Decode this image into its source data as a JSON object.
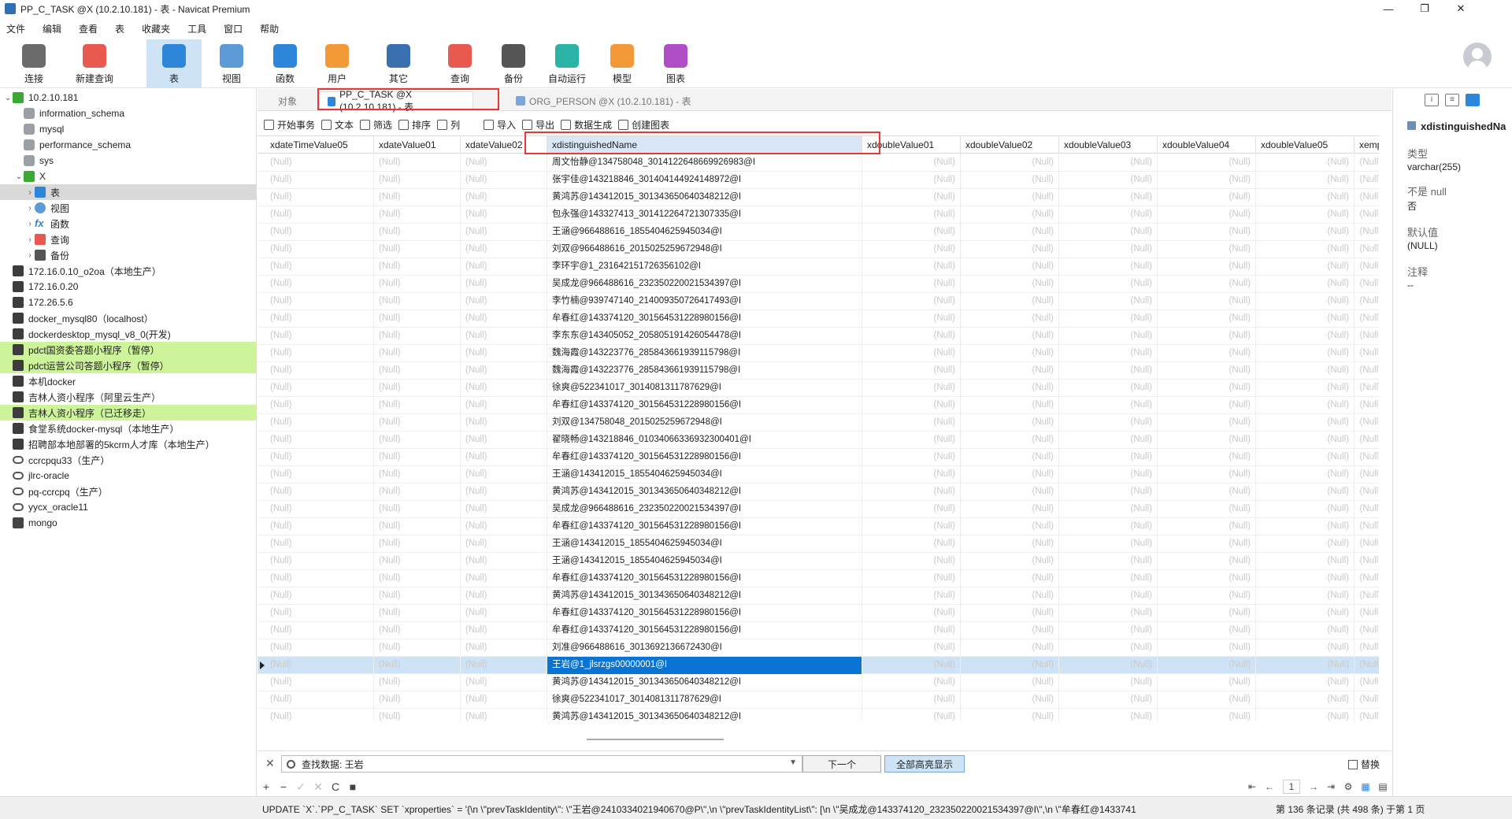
{
  "window": {
    "title": "PP_C_TASK @X (10.2.10.181) - 表 - Navicat Premium",
    "minimize": "—",
    "maximize": "❐",
    "close": "✕"
  },
  "menu": [
    "文件",
    "编辑",
    "查看",
    "表",
    "收藏夹",
    "工具",
    "窗口",
    "帮助"
  ],
  "toolbar": [
    {
      "label": "连接",
      "icon": "plug-icon",
      "color": "#6b6b6b"
    },
    {
      "label": "新建查询",
      "icon": "new-query-icon",
      "color": "#e85a4f"
    },
    {
      "label": "表",
      "icon": "table-icon",
      "color": "#2d86d9",
      "active": true
    },
    {
      "label": "视图",
      "icon": "view-icon",
      "color": "#5c9bd6"
    },
    {
      "label": "函数",
      "icon": "function-icon",
      "color": "#2d86d9"
    },
    {
      "label": "用户",
      "icon": "user-icon",
      "color": "#f29a38"
    },
    {
      "label": "其它",
      "icon": "tools-icon",
      "color": "#3a6fb0"
    },
    {
      "label": "查询",
      "icon": "query-icon",
      "color": "#e85a4f"
    },
    {
      "label": "备份",
      "icon": "backup-icon",
      "color": "#555555"
    },
    {
      "label": "自动运行",
      "icon": "robot-icon",
      "color": "#2bb3a6"
    },
    {
      "label": "模型",
      "icon": "model-icon",
      "color": "#f29a38"
    },
    {
      "label": "图表",
      "icon": "chart-icon",
      "color": "#b04ec7"
    }
  ],
  "sidebar": {
    "items": [
      {
        "label": "10.2.10.181",
        "indent": 0,
        "arrow": "v",
        "icon": "srvg"
      },
      {
        "label": "information_schema",
        "indent": 1,
        "arrow": "",
        "icon": "db"
      },
      {
        "label": "mysql",
        "indent": 1,
        "arrow": "",
        "icon": "db"
      },
      {
        "label": "performance_schema",
        "indent": 1,
        "arrow": "",
        "icon": "db"
      },
      {
        "label": "sys",
        "indent": 1,
        "arrow": "",
        "icon": "db"
      },
      {
        "label": "X",
        "indent": 1,
        "arrow": "v",
        "icon": "srvg"
      },
      {
        "label": "表",
        "indent": 2,
        "arrow": ">",
        "icon": "tbl",
        "state": "sel"
      },
      {
        "label": "视图",
        "indent": 2,
        "arrow": ">",
        "icon": "view"
      },
      {
        "label": "函数",
        "indent": 2,
        "arrow": ">",
        "icon": "fx"
      },
      {
        "label": "查询",
        "indent": 2,
        "arrow": ">",
        "icon": "qry"
      },
      {
        "label": "备份",
        "indent": 2,
        "arrow": ">",
        "icon": "bak"
      },
      {
        "label": "172.16.0.10_o2oa（本地生产）",
        "indent": 0,
        "arrow": "",
        "icon": "srv"
      },
      {
        "label": "172.16.0.20",
        "indent": 0,
        "arrow": "",
        "icon": "srv"
      },
      {
        "label": "172.26.5.6",
        "indent": 0,
        "arrow": "",
        "icon": "srv"
      },
      {
        "label": "docker_mysql80（localhost）",
        "indent": 0,
        "arrow": "",
        "icon": "srv"
      },
      {
        "label": "dockerdesktop_mysql_v8_0(开发)",
        "indent": 0,
        "arrow": "",
        "icon": "srv"
      },
      {
        "label": "pdct国资委答题小程序（暂停）",
        "indent": 0,
        "arrow": "",
        "icon": "srv",
        "state": "hl"
      },
      {
        "label": "pdct运营公司答题小程序（暂停）",
        "indent": 0,
        "arrow": "",
        "icon": "srv",
        "state": "hl"
      },
      {
        "label": "本机docker",
        "indent": 0,
        "arrow": "",
        "icon": "srv"
      },
      {
        "label": "吉林人资小程序（阿里云生产）",
        "indent": 0,
        "arrow": "",
        "icon": "srv"
      },
      {
        "label": "吉林人资小程序（已迁移走）",
        "indent": 0,
        "arrow": "",
        "icon": "srv",
        "state": "hl"
      },
      {
        "label": "食堂系统docker-mysql（本地生产）",
        "indent": 0,
        "arrow": "",
        "icon": "srv"
      },
      {
        "label": "招聘部本地部署的5kcrm人才库（本地生产）",
        "indent": 0,
        "arrow": "",
        "icon": "srv"
      },
      {
        "label": "ccrcpqu33（生产）",
        "indent": 0,
        "arrow": "",
        "icon": "ora"
      },
      {
        "label": "jlrc-oracle",
        "indent": 0,
        "arrow": "",
        "icon": "ora"
      },
      {
        "label": "pq-ccrcpq（生产）",
        "indent": 0,
        "arrow": "",
        "icon": "ora"
      },
      {
        "label": "yycx_oracle11",
        "indent": 0,
        "arrow": "",
        "icon": "ora"
      },
      {
        "label": "mongo",
        "indent": 0,
        "arrow": "",
        "icon": "mongo"
      }
    ]
  },
  "tabs": {
    "objects": "对象",
    "active": "PP_C_TASK @X (10.2.10.181) - 表",
    "other": "ORG_PERSON @X (10.2.10.181) - 表"
  },
  "subtoolbar": [
    "开始事务",
    "文本",
    "筛选",
    "排序",
    "列",
    "导入",
    "导出",
    "数据生成",
    "创建图表"
  ],
  "grid": {
    "columns": [
      "xdateTimeValue05",
      "xdateValue01",
      "xdateValue02",
      "xdistinguishedName",
      "xdoubleValue01",
      "xdoubleValue02",
      "xdoubleValue03",
      "xdoubleValue04",
      "xdoubleValue05",
      "xemp"
    ],
    "null_text": "(Null)",
    "names": [
      "周文怡静@134758048_3014122648669926983@I",
      "张宇佳@143218846_3014041449241489​72@I",
      "黄鸿苏@143412015_3013436506403482​12@I",
      "包永强@143327413_3014122647213073​35@I",
      "王涵@966488616_1855404625945034@I",
      "刘双@966488616_2015025259672948@I",
      "李环宇@1_2316421517263561​02@I",
      "吴成龙@966488616_2323502200215343​97@I",
      "李竹楠@939747140_2140093507264174​93@I",
      "牟春红@143374120_3015645312289801​56@I",
      "李东东@143405052_2058051914260544​78@I",
      "魏海霞@143223776_2858436619391157​98@I",
      "魏海霞@143223776_2858436619391157​98@I",
      "徐爽@522341017_3014081311787629@I",
      "牟春红@143374120_3015645312289801​56@I",
      "刘双@134758048_2015025259672948@I",
      "翟晓畅@143218846_0103406633693230​0401@I",
      "牟春红@143374120_3015645312289801​56@I",
      "王涵@143412015_1855404625945034@I",
      "黄鸿苏@143412015_3013436506403482​12@I",
      "吴成龙@966488616_2323502200215343​97@I",
      "牟春红@143374120_3015645312289801​56@I",
      "王涵@143412015_1855404625945034@I",
      "王涵@143412015_1855404625945034@I",
      "牟春红@143374120_3015645312289801​56@I",
      "黄鸿苏@143412015_3013436506403482​12@I",
      "牟春红@143374120_3015645312289801​56@I",
      "牟春红@143374120_3015645312289801​56@I",
      "刘准@966488616_3013692136672430@I",
      "王岩@1_jlsrzgs00000001@I",
      "黄鸿苏@143412015_3013436506403482​12@I",
      "徐爽@522341017_3014081311787629@I",
      "黄鸿苏@143412015_3013436506403482​12@I"
    ],
    "current_row": 29
  },
  "find": {
    "value": "查找数据: 王岩",
    "next": "下一个",
    "highlight_all": "全部高亮显示",
    "replace": "替换"
  },
  "editbar": [
    "+",
    "−",
    "✓",
    "✕",
    "C",
    "■"
  ],
  "pager": {
    "first": "⇤",
    "prev": "←",
    "page": "1",
    "next": "→",
    "last": "⇥",
    "settings": "⚙"
  },
  "status": {
    "sql": "UPDATE `X`.`PP_C_TASK` SET `xproperties` = '{\\n  \\\"prevTaskIdentity\\\": \\\"王岩@2410334021940670@P\\\",\\n  \\\"prevTaskIdentityList\\\": [\\n    \\\"吴成龙@143374120_2323502200215343​97@I\\\",\\n    \\\"牟春红@1433741",
    "count": "第 136 条记录 (共 498 条) 于第 1 页"
  },
  "rightpanel": {
    "field": "xdistinguishedNa",
    "type_label": "类型",
    "type_value": "varchar(255)",
    "notnull_label": "不是 null",
    "notnull_value": "否",
    "default_label": "默认值",
    "default_value": "(NULL)",
    "comment_label": "注释",
    "comment_value": "--"
  }
}
